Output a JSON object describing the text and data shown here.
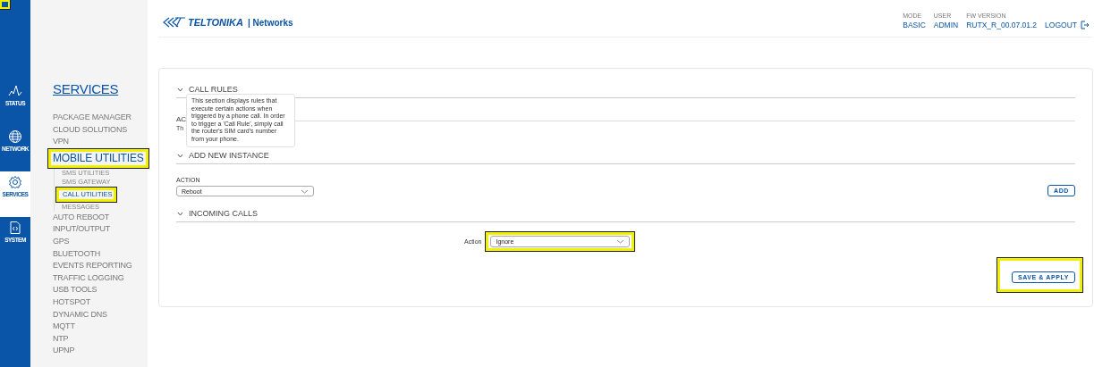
{
  "corner_marker": {
    "highlighted": true
  },
  "rail": [
    {
      "label": "STATUS",
      "selected": false
    },
    {
      "label": "NETWORK",
      "selected": false
    },
    {
      "label": "SERVICES",
      "selected": true
    },
    {
      "label": "SYSTEM",
      "selected": false
    }
  ],
  "sidebar": {
    "title": "SERVICES",
    "items": [
      {
        "label": "PACKAGE MANAGER",
        "selected": false,
        "highlighted": false
      },
      {
        "label": "CLOUD SOLUTIONS",
        "selected": false,
        "highlighted": false
      },
      {
        "label": "VPN",
        "selected": false,
        "highlighted": false
      },
      {
        "label": "MOBILE UTILITIES",
        "selected": true,
        "highlighted": true,
        "children": [
          {
            "label": "SMS UTILITIES",
            "selected": false,
            "highlighted": false
          },
          {
            "label": "SMS GATEWAY",
            "selected": false,
            "highlighted": false
          },
          {
            "label": "CALL UTILITIES",
            "selected": true,
            "highlighted": true
          },
          {
            "label": "MESSAGES",
            "selected": false,
            "highlighted": false
          }
        ]
      },
      {
        "label": "AUTO REBOOT",
        "selected": false,
        "highlighted": false
      },
      {
        "label": "INPUT/OUTPUT",
        "selected": false,
        "highlighted": false
      },
      {
        "label": "GPS",
        "selected": false,
        "highlighted": false
      },
      {
        "label": "BLUETOOTH",
        "selected": false,
        "highlighted": false
      },
      {
        "label": "EVENTS REPORTING",
        "selected": false,
        "highlighted": false
      },
      {
        "label": "TRAFFIC LOGGING",
        "selected": false,
        "highlighted": false
      },
      {
        "label": "USB TOOLS",
        "selected": false,
        "highlighted": false
      },
      {
        "label": "HOTSPOT",
        "selected": false,
        "highlighted": false
      },
      {
        "label": "DYNAMIC DNS",
        "selected": false,
        "highlighted": false
      },
      {
        "label": "MQTT",
        "selected": false,
        "highlighted": false
      },
      {
        "label": "NTP",
        "selected": false,
        "highlighted": false
      },
      {
        "label": "UPNP",
        "selected": false,
        "highlighted": false
      }
    ]
  },
  "header": {
    "brand": "TELTONIKA",
    "brand_suffix": "| Networks",
    "info": [
      {
        "label": "MODE",
        "value": "BASIC"
      },
      {
        "label": "USER",
        "value": "ADMIN"
      },
      {
        "label": "FW VERSION",
        "value": "RUTX_R_00.07.01.2"
      }
    ],
    "logout": "LOGOUT"
  },
  "call_rules": {
    "title": "CALL RULES",
    "expanded": true,
    "subtitle": "AC",
    "text": "Th",
    "tooltip": "This section displays rules that execute certain actions when triggered by a phone call. In order to trigger a 'Call Rule', simply call the router's SIM card's number from your phone."
  },
  "add_new_instance": {
    "title": "ADD NEW INSTANCE",
    "expanded": true,
    "field_label": "ACTION",
    "value": "Reboot",
    "button": "ADD"
  },
  "incoming_calls": {
    "title": "INCOMING CALLS",
    "expanded": true,
    "field_label": "Action",
    "value": "Ignore",
    "highlighted": true
  },
  "save_button": {
    "label": "SAVE & APPLY",
    "highlighted": true
  }
}
